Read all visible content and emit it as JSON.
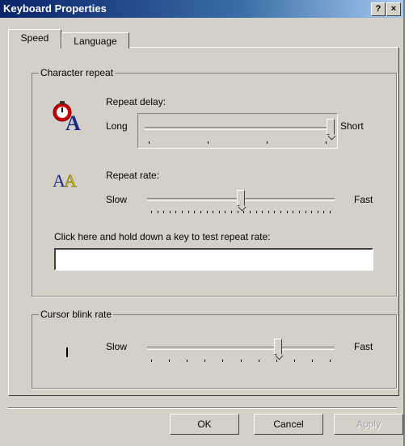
{
  "window": {
    "title": "Keyboard Properties"
  },
  "titlebar": {
    "help_label": "?",
    "close_label": "×"
  },
  "tabs": [
    {
      "label": "Speed"
    },
    {
      "label": "Language"
    }
  ],
  "character_repeat": {
    "group_label": "Character repeat",
    "repeat_delay": {
      "label": "Repeat delay:",
      "min_label": "Long",
      "max_label": "Short",
      "value": 1.0,
      "ticks": 4
    },
    "repeat_rate": {
      "label": "Repeat rate:",
      "min_label": "Slow",
      "max_label": "Fast",
      "value": 0.5,
      "ticks": 30
    },
    "test_label": "Click here and hold down a key to test repeat rate:",
    "test_value": ""
  },
  "cursor_blink": {
    "group_label": "Cursor blink rate",
    "min_label": "Slow",
    "max_label": "Fast",
    "value": 0.7,
    "ticks": 11
  },
  "buttons": {
    "ok": "OK",
    "cancel": "Cancel",
    "apply": "Apply"
  }
}
